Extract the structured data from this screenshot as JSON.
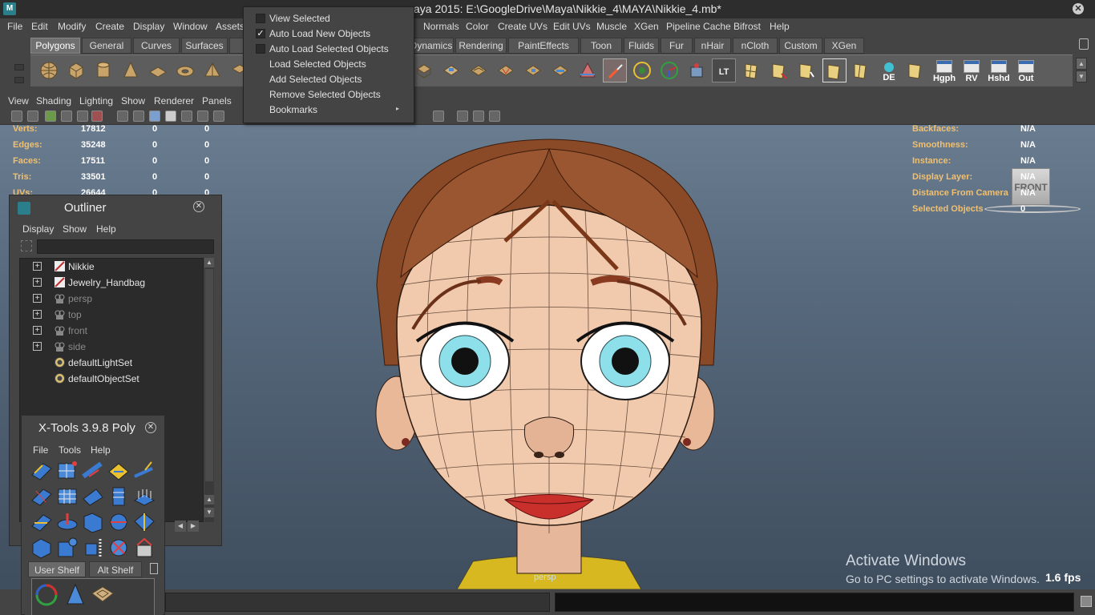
{
  "window": {
    "title": "aya 2015: E:\\GoogleDrive\\Maya\\Nikkie_4\\MAYA\\Nikkie_4.mb*"
  },
  "main_menu": [
    "File",
    "Edit",
    "Modify",
    "Create",
    "Display",
    "Window",
    "Assets",
    "Normals",
    "Color",
    "Create UVs",
    "Edit UVs",
    "Muscle",
    "XGen",
    "Pipeline Cache",
    "Bifrost",
    "Help"
  ],
  "shelf": {
    "tabs": [
      "Polygons",
      "General",
      "Curves",
      "Surfaces",
      "Dynamics",
      "Rendering",
      "PaintEffects",
      "Toon",
      "Fluids",
      "Fur",
      "nHair",
      "nCloth",
      "Custom",
      "XGen"
    ],
    "active_tab": "Polygons",
    "labeled_buttons": [
      "LT",
      "DE",
      "Hgph",
      "RV",
      "Hshd",
      "Out"
    ]
  },
  "panel_menu": [
    "View",
    "Shading",
    "Lighting",
    "Show",
    "Renderer",
    "Panels"
  ],
  "isolate_menu": {
    "items": [
      {
        "label": "View Selected",
        "checkbox": true,
        "checked": false
      },
      {
        "label": "Auto Load New Objects",
        "checkbox": true,
        "checked": true
      },
      {
        "label": "Auto Load Selected Objects",
        "checkbox": true,
        "checked": false
      },
      {
        "label": "Load Selected Objects",
        "checkbox": false
      },
      {
        "label": "Add Selected Objects",
        "checkbox": false
      },
      {
        "label": "Remove Selected Objects",
        "checkbox": false
      },
      {
        "label": "Bookmarks",
        "checkbox": false,
        "submenu": true
      }
    ]
  },
  "hud_left": [
    {
      "label": "Verts:",
      "v1": "17812",
      "v2": "0",
      "v3": "0"
    },
    {
      "label": "Edges:",
      "v1": "35248",
      "v2": "0",
      "v3": "0"
    },
    {
      "label": "Faces:",
      "v1": "17511",
      "v2": "0",
      "v3": "0"
    },
    {
      "label": "Tris:",
      "v1": "33501",
      "v2": "0",
      "v3": "0"
    },
    {
      "label": "UVs:",
      "v1": "26644",
      "v2": "0",
      "v3": "0"
    }
  ],
  "hud_right": [
    {
      "label": "Backfaces:",
      "value": "N/A"
    },
    {
      "label": "Smoothness:",
      "value": "N/A"
    },
    {
      "label": "Instance:",
      "value": "N/A"
    },
    {
      "label": "Display Layer:",
      "value": "N/A"
    },
    {
      "label": "Distance From Camera",
      "value": "N/A"
    },
    {
      "label": "Selected Objects",
      "value": "0"
    }
  ],
  "view_cube": {
    "label": "FRONT"
  },
  "viewport": {
    "camera_label": "persp",
    "fps": "1.6 fps",
    "watermark_title": "Activate Windows",
    "watermark_sub": "Go to PC settings to activate Windows."
  },
  "outliner": {
    "title": "Outliner",
    "menu": [
      "Display",
      "Show",
      "Help"
    ],
    "search_value": "",
    "items": [
      {
        "name": "Nikkie",
        "expand": true,
        "icon": "transform-icon",
        "dim": false
      },
      {
        "name": "Jewelry_Handbag",
        "expand": true,
        "icon": "transform-icon",
        "dim": false
      },
      {
        "name": "persp",
        "expand": true,
        "icon": "camera-icon",
        "dim": true
      },
      {
        "name": "top",
        "expand": true,
        "icon": "camera-icon",
        "dim": true
      },
      {
        "name": "front",
        "expand": true,
        "icon": "camera-icon",
        "dim": true
      },
      {
        "name": "side",
        "expand": true,
        "icon": "camera-icon",
        "dim": true
      },
      {
        "name": "defaultLightSet",
        "expand": false,
        "icon": "set-icon",
        "dim": false
      },
      {
        "name": "defaultObjectSet",
        "expand": false,
        "icon": "set-icon",
        "dim": false
      }
    ]
  },
  "xtools": {
    "title": "X-Tools 3.9.8 Poly",
    "menu": [
      "File",
      "Tools",
      "Help"
    ],
    "tabs": [
      "User Shelf",
      "Alt Shelf"
    ],
    "active_tab": "User Shelf"
  },
  "colors": {
    "hud_label": "#f0c070",
    "hud_value": "#ffffff",
    "shelf_active_tab": "#6f6f6f",
    "viewport_top": "#6a7c90",
    "viewport_bottom": "#3f4e5e"
  }
}
